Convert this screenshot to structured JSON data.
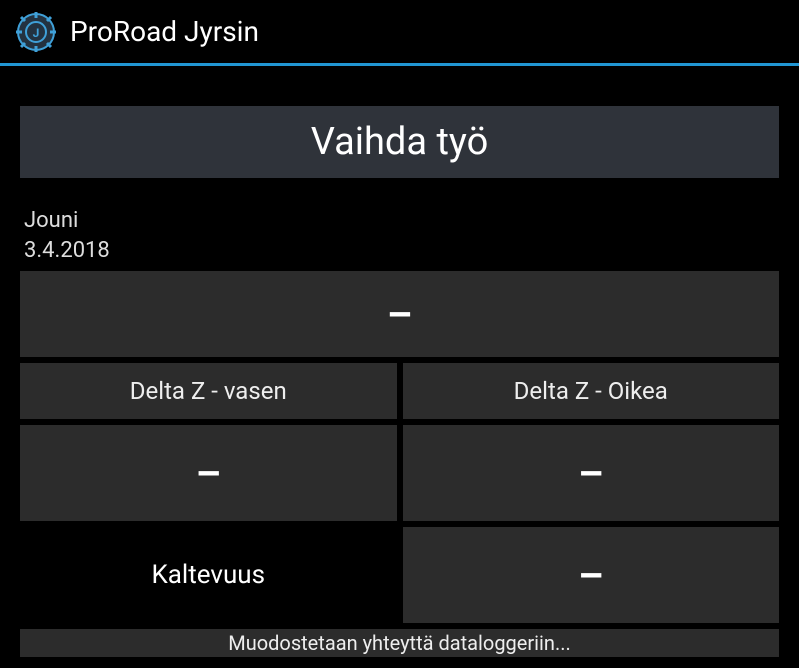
{
  "app": {
    "title": "ProRoad Jyrsin"
  },
  "main": {
    "change_job_label": "Vaihda työ",
    "user": "Jouni",
    "date": "3.4.2018",
    "top_value": "–",
    "delta_left_label": "Delta Z - vasen",
    "delta_right_label": "Delta Z - Oikea",
    "delta_left_value": "–",
    "delta_right_value": "–",
    "slope_label": "Kaltevuus",
    "slope_value": "–",
    "status": "Muodostetaan yhteyttä dataloggeriin..."
  }
}
